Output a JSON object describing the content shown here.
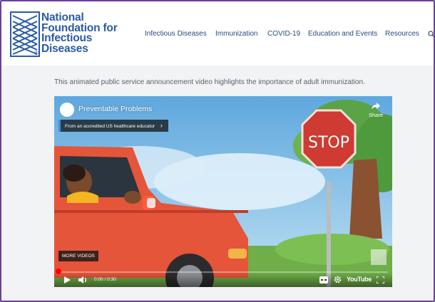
{
  "brand": {
    "name_lines": [
      "National",
      "Foundation for",
      "Infectious",
      "Diseases"
    ],
    "registered": "®",
    "color": "#2a5ba6"
  },
  "nav": {
    "items": [
      {
        "label": "Infectious Diseases"
      },
      {
        "label": "Immunization"
      },
      {
        "label": "COVID-19"
      },
      {
        "label": "Education and Events"
      },
      {
        "label": "Resources"
      }
    ],
    "search_icon": "search-icon"
  },
  "main": {
    "intro_text": "This animated public service announcement video highlights the importance of adult immunization."
  },
  "video": {
    "title": "Preventable Problems",
    "edu_badge": "From an accredited US healthcare educator",
    "edu_chevron": "›",
    "share_label": "Share",
    "stop_sign_text": "STOP",
    "more_videos_label": "MORE VIDEOS",
    "time": "0:00 / 0:30",
    "progress_fraction": 0.0,
    "youtube_label": "YouTube",
    "accent": "#ff0000"
  }
}
